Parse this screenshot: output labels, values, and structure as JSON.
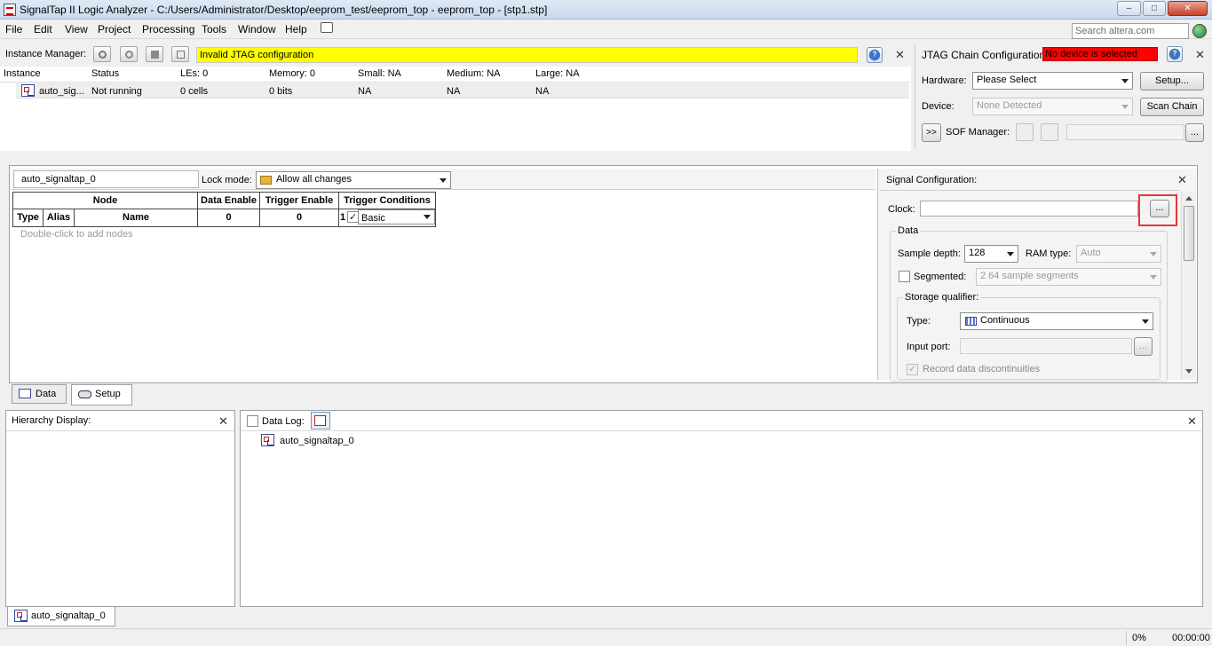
{
  "window": {
    "title": "SignalTap II Logic Analyzer - C:/Users/Administrator/Desktop/eeprom_test/eeprom_top - eeprom_top - [stp1.stp]",
    "minimize_label": "‒",
    "maximize_label": "□",
    "close_label": "✕"
  },
  "menu": {
    "items": [
      "File",
      "Edit",
      "View",
      "Project",
      "Processing",
      "Tools",
      "Window",
      "Help"
    ],
    "search_placeholder": "Search altera.com"
  },
  "instance_manager": {
    "label": "Instance Manager:",
    "status_message": "Invalid JTAG configuration",
    "status_color": "#ffff00",
    "columns": [
      "Instance",
      "Status",
      "LEs: 0",
      "Memory: 0",
      "Small: NA",
      "Medium: NA",
      "Large: NA"
    ],
    "rows": [
      {
        "instance": "auto_sig...",
        "status": "Not running",
        "les": "0 cells",
        "memory": "0 bits",
        "small": "NA",
        "medium": "NA",
        "large": "NA"
      }
    ]
  },
  "jtag": {
    "label": "JTAG Chain Configuration:",
    "status": "No device is selected",
    "status_color": "#ff0000",
    "hardware_label": "Hardware:",
    "hardware_value": "Please Select",
    "setup_button": "Setup...",
    "device_label": "Device:",
    "device_value": "None Detected",
    "scan_chain_button": "Scan Chain",
    "expand_button": ">>",
    "sof_label": "SOF Manager:",
    "browse_button": "..."
  },
  "setup": {
    "instance_name": "auto_signaltap_0",
    "lock_mode_label": "Lock mode:",
    "lock_mode_value": "Allow all changes",
    "node_table": {
      "header_node": "Node",
      "header_data_enable": "Data Enable",
      "header_trigger_enable": "Trigger Enable",
      "header_trigger_conditions": "Trigger Conditions",
      "sub_type": "Type",
      "sub_alias": "Alias",
      "sub_name": "Name",
      "data_enable_count": "0",
      "trigger_enable_count": "0",
      "trigger_index": "1",
      "trigger_value": "Basic",
      "empty_hint": "Double-click to add nodes"
    },
    "tabs": [
      "Data",
      "Setup"
    ]
  },
  "signal_config": {
    "title": "Signal Configuration:",
    "clock_label": "Clock:",
    "clock_value": "",
    "clock_browse": "...",
    "data_group": "Data",
    "sample_depth_label": "Sample depth:",
    "sample_depth_value": "128",
    "ram_type_label": "RAM type:",
    "ram_type_value": "Auto",
    "segmented_label": "Segmented:",
    "segmented_value": "2  64 sample segments",
    "storage_qualifier_group": "Storage qualifier:",
    "type_label": "Type:",
    "type_value": "Continuous",
    "input_port_label": "Input port:",
    "input_port_browse": "...",
    "record_discontinuities_label": "Record data discontinuities",
    "highlight_color": "#e53935"
  },
  "hierarchy": {
    "title": "Hierarchy Display:"
  },
  "data_log": {
    "title": "Data Log:",
    "items": [
      "auto_signaltap_0"
    ]
  },
  "bottom_tab": "auto_signaltap_0",
  "status_bar": {
    "progress": "0%",
    "time": "00:00:00"
  }
}
